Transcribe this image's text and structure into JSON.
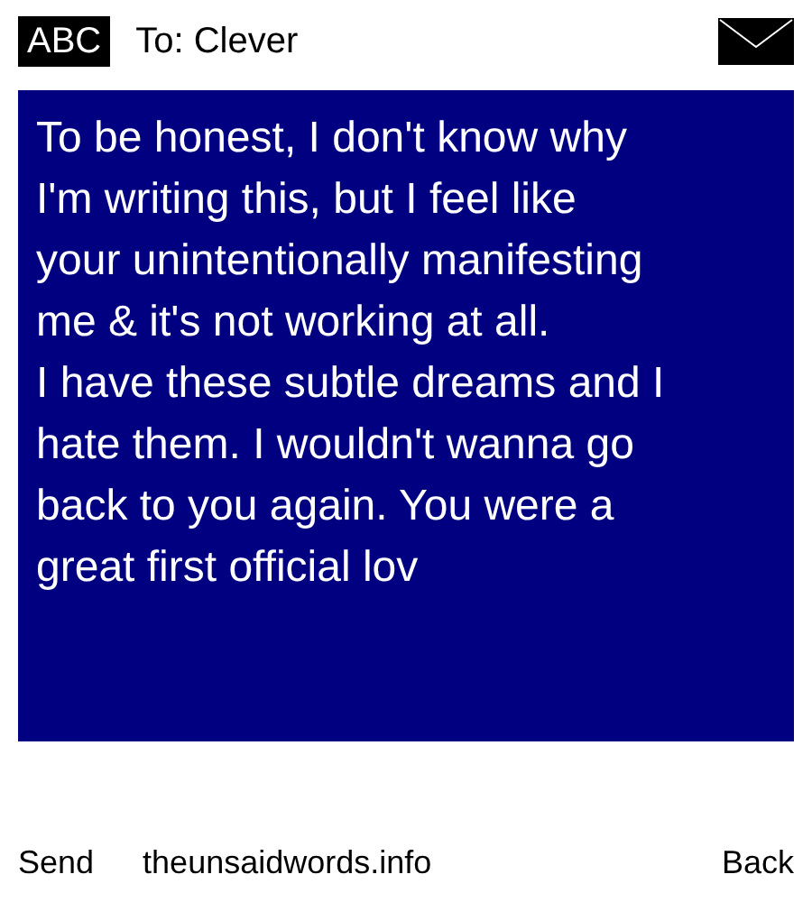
{
  "header": {
    "input_mode": "ABC",
    "recipient": "To: Clever"
  },
  "message": {
    "lines": [
      "To be honest, I don't know why",
      "I'm writing this, but I feel like",
      "your unintentionally manifesting",
      "me & it's not working at all.",
      "I have these subtle dreams and I",
      "hate them. I wouldn't wanna go",
      "back to you again. You were a",
      "great first official lov"
    ]
  },
  "footer": {
    "left": "Send",
    "center": "theunsaidwords.info",
    "right": "Back"
  }
}
